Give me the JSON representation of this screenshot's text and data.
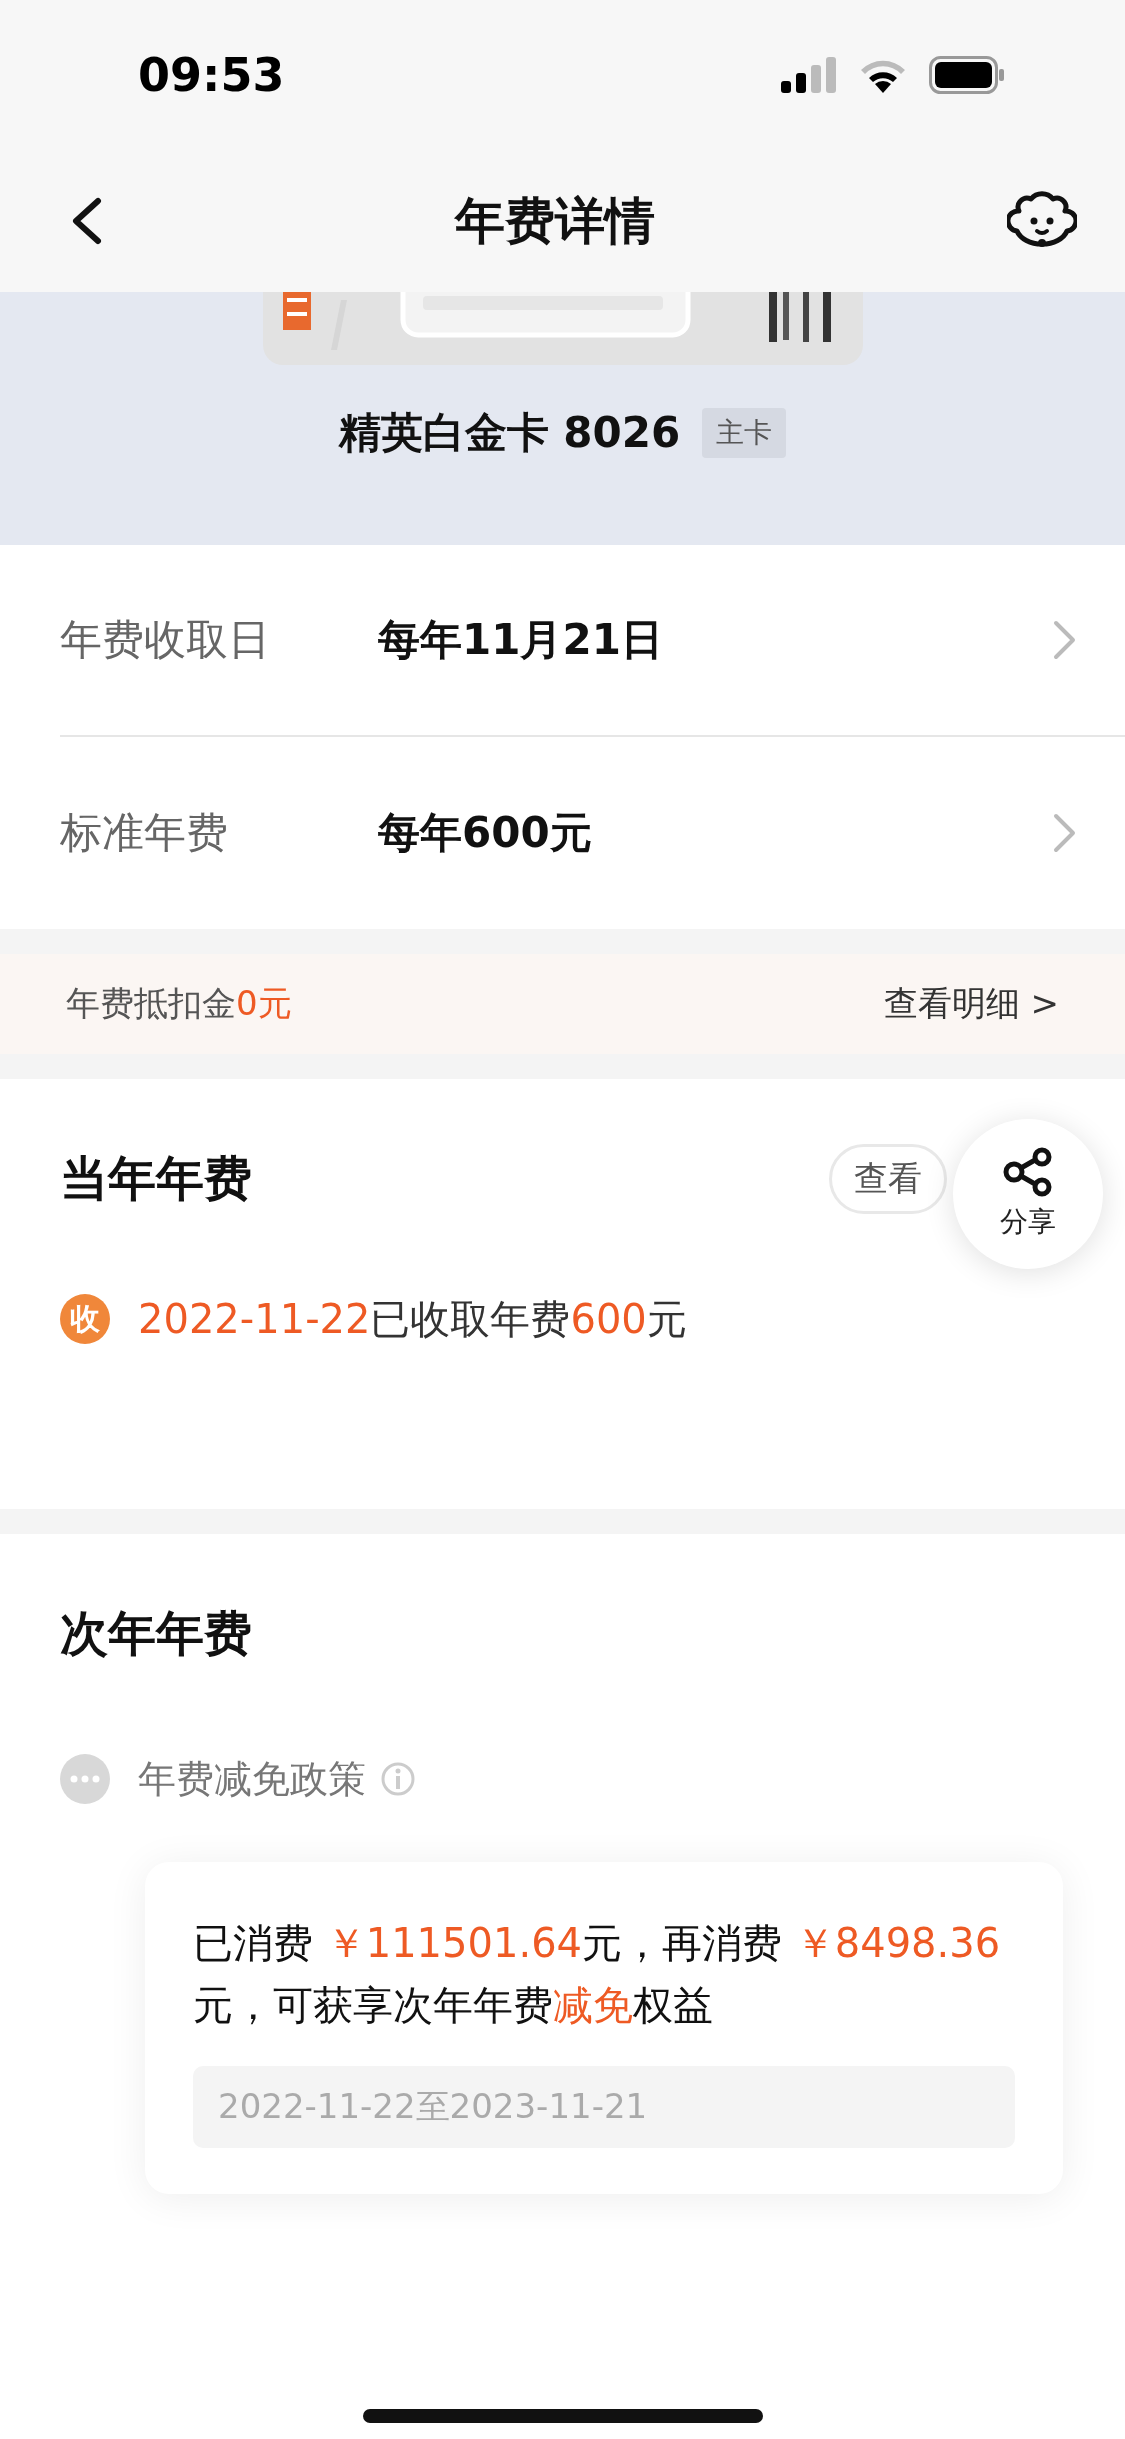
{
  "status_bar": {
    "time": "09:53"
  },
  "nav": {
    "title": "年费详情"
  },
  "card": {
    "name": "精英白金卡 8026",
    "tag": "主卡"
  },
  "info_rows": [
    {
      "label": "年费收取日",
      "value": "每年11月21日"
    },
    {
      "label": "标准年费",
      "value": "每年600元"
    }
  ],
  "deduction": {
    "label": "年费抵扣金",
    "amount": "0元",
    "link": "查看明细 >"
  },
  "current_year": {
    "title": "当年年费",
    "bill_button": "查看",
    "record": {
      "badge": "收",
      "parts": [
        {
          "text": "2022-11-22",
          "highlight": true
        },
        {
          "text": "已收取年费",
          "highlight": false
        },
        {
          "text": "600",
          "highlight": true
        },
        {
          "text": "元",
          "highlight": false
        }
      ]
    }
  },
  "share": {
    "label": "分享"
  },
  "next_year": {
    "title": "次年年费",
    "policy": "年费减免政策",
    "progress": [
      {
        "text": "已消费 ",
        "highlight": false
      },
      {
        "text": "￥111501.64",
        "highlight": true
      },
      {
        "text": "元，再消费 ",
        "highlight": false
      },
      {
        "text": "￥8498.36",
        "highlight": true
      },
      {
        "text": "元，可获享次年年费",
        "highlight": false
      },
      {
        "text": "减免",
        "highlight": true
      },
      {
        "text": "权益",
        "highlight": false
      }
    ],
    "period": "2022-11-22至2023-11-21"
  }
}
